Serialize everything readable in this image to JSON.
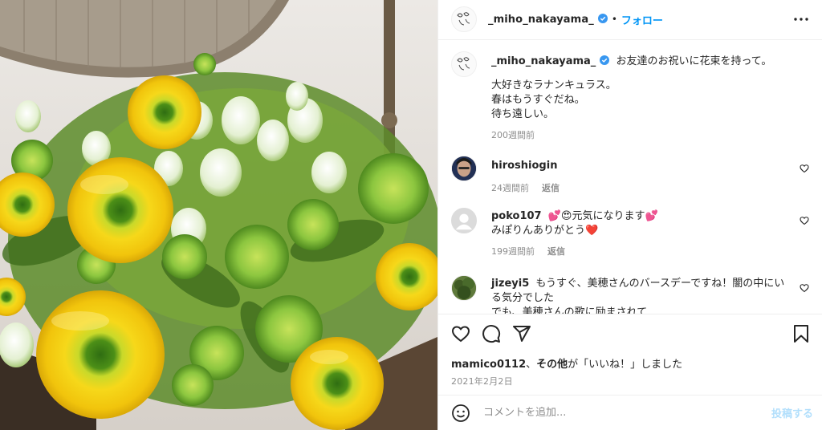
{
  "post": {
    "username": "_miho_nakayama_",
    "follow_label": "フォロー",
    "dot": "•"
  },
  "caption": {
    "username": "_miho_nakayama_",
    "lines": [
      "お友達のお祝いに花束を持って。",
      "大好きなラナンキュラス。",
      "春はもうすぐだね。",
      "待ち遠しい。"
    ],
    "time": "200週間前"
  },
  "comments": [
    {
      "username": "hiroshiogin",
      "text": "",
      "time": "24週間前",
      "reply": "返信"
    },
    {
      "username": "poko107",
      "text": "💕😍元気になります💕",
      "text2": "みぽりんありがとう❤️",
      "time": "199週間前",
      "reply": "返信"
    },
    {
      "username": "jizeyi5",
      "text": "もうすぐ、美穂さんのバースデーですね！闇の中にい",
      "text2": "る気分でした",
      "text3": "でも、美穂さんの歌に励まされて"
    }
  ],
  "likes": {
    "first_user": "mamico0112",
    "separator": "、",
    "others": "その他",
    "suffix": "が「いいね！」しました"
  },
  "date": "2021年2月2日",
  "add_comment": {
    "placeholder": "コメントを追加...",
    "post_label": "投稿する"
  },
  "colors": {
    "accent": "#0095f6",
    "verified": "#3897f0",
    "flower_yellow": "#f5d315",
    "leaf_green": "#8cc63f",
    "like_heart": "#ed4956"
  },
  "icons": [
    "verified-icon",
    "more-icon",
    "heart-icon",
    "comment-icon",
    "share-icon",
    "bookmark-icon",
    "emoji-icon"
  ]
}
